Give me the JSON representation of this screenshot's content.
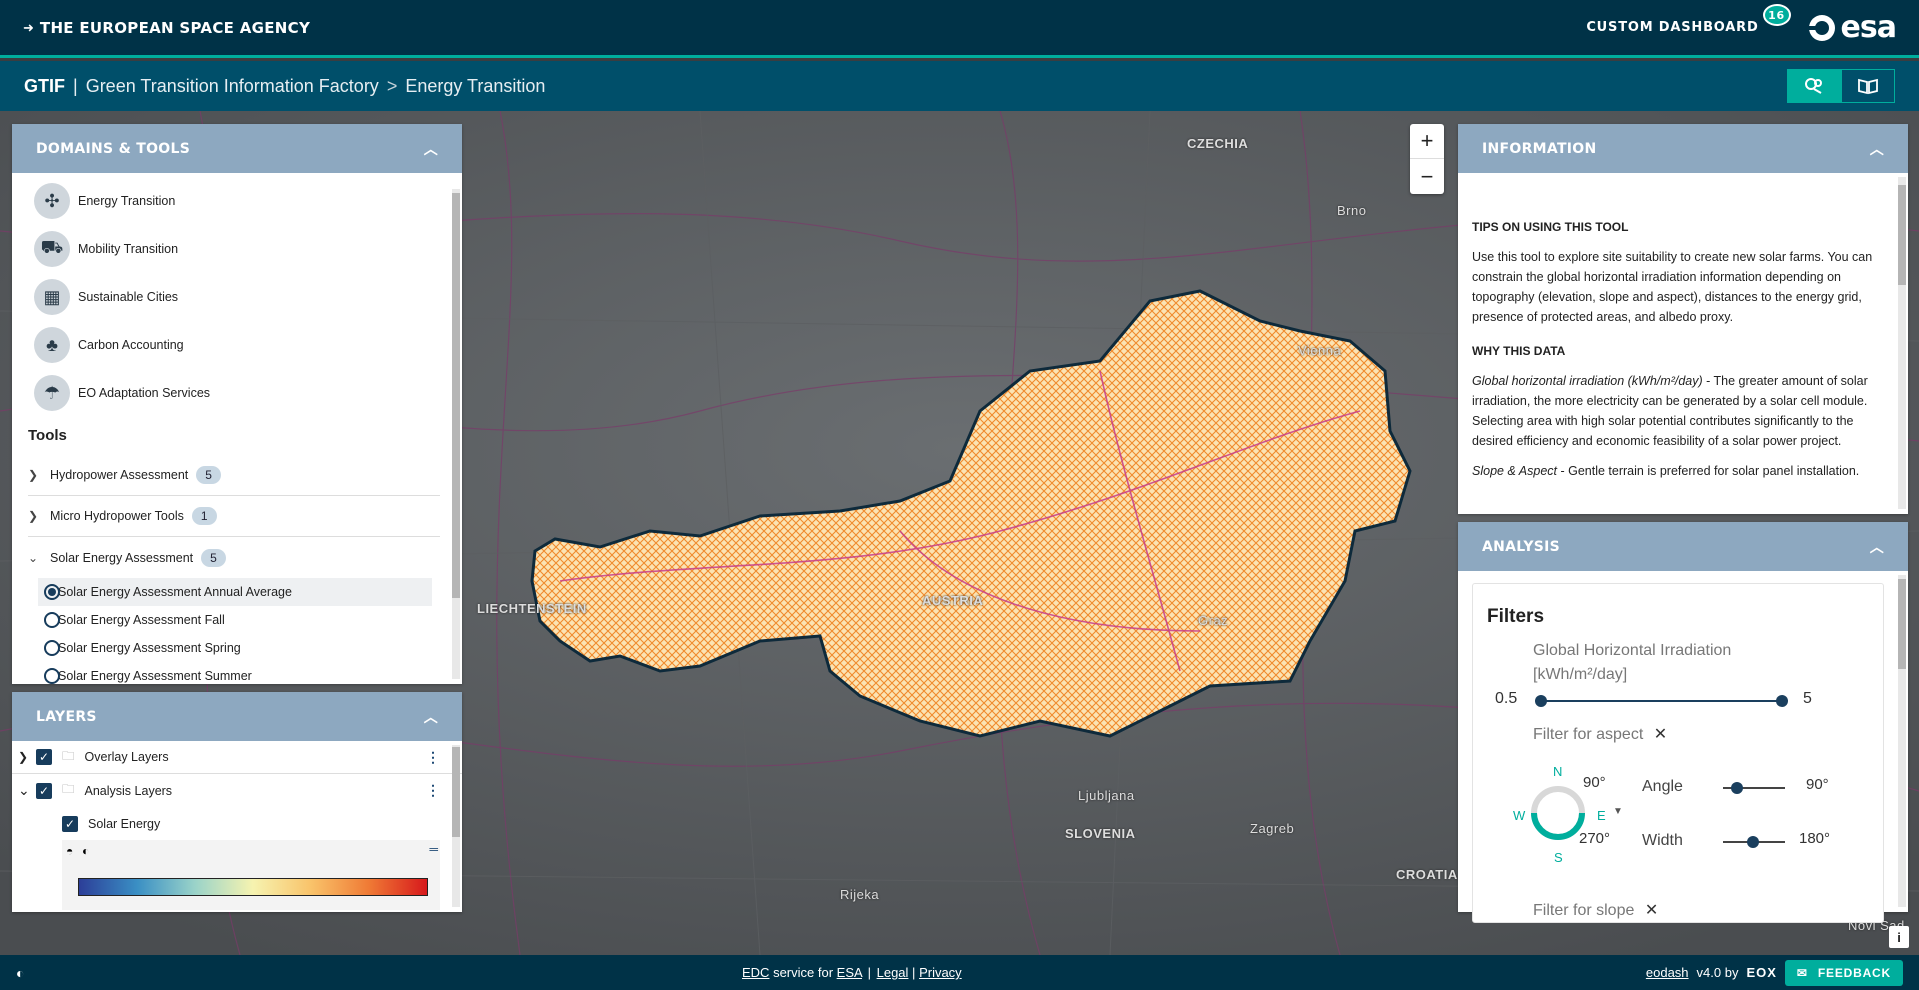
{
  "header": {
    "title": "THE EUROPEAN SPACE AGENCY",
    "custom_dashboard": "CUSTOM DASHBOARD",
    "dashboard_count": "16",
    "logo_text": "esa"
  },
  "breadcrumb": {
    "root": "GTIF",
    "separator": "|",
    "section": "Green Transition Information Factory",
    "arrow": ">",
    "page": "Energy Transition"
  },
  "domains_panel": {
    "title": "DOMAINS & TOOLS",
    "domains": [
      {
        "label": "Energy Transition",
        "icon": "wind-turbine-icon"
      },
      {
        "label": "Mobility Transition",
        "icon": "vehicle-icon"
      },
      {
        "label": "Sustainable Cities",
        "icon": "city-icon"
      },
      {
        "label": "Carbon Accounting",
        "icon": "forest-icon"
      },
      {
        "label": "EO Adaptation Services",
        "icon": "adaptation-icon"
      }
    ],
    "tools_heading": "Tools",
    "tools": [
      {
        "label": "Hydropower Assessment",
        "count": "5",
        "expanded": false
      },
      {
        "label": "Micro Hydropower Tools",
        "count": "1",
        "expanded": false
      },
      {
        "label": "Solar Energy Assessment",
        "count": "5",
        "expanded": true
      }
    ],
    "solar_options": [
      {
        "label": "Solar Energy Assessment Annual Average",
        "selected": true
      },
      {
        "label": "Solar Energy Assessment Fall",
        "selected": false
      },
      {
        "label": "Solar Energy Assessment Spring",
        "selected": false
      },
      {
        "label": "Solar Energy Assessment Summer",
        "selected": false
      }
    ]
  },
  "layers_panel": {
    "title": "LAYERS",
    "items": [
      {
        "label": "Overlay Layers"
      },
      {
        "label": "Analysis Layers"
      },
      {
        "label": "Solar Energy"
      }
    ]
  },
  "info_panel": {
    "title": "INFORMATION",
    "tips_heading": "TIPS ON USING THIS TOOL",
    "tips_text": "Use this tool to explore site suitability to create new solar farms. You can constrain the global horizontal irradiation information depending on topography (elevation, slope and aspect), distances to the energy grid, presence of protected areas, and albedo proxy.",
    "why_heading": "WHY THIS DATA",
    "why_term": "Global horizontal irradiation (kWh/m²/day)",
    "why_text": " - The greater amount of solar irradiation, the more electricity can be generated by a solar cell module. Selecting area with high solar potential contributes significantly to the desired efficiency and economic feasibility of a solar power project.",
    "slope_term": "Slope & Aspect",
    "slope_text": " - Gentle terrain is preferred for solar panel installation."
  },
  "analysis_panel": {
    "title": "ANALYSIS",
    "filters_heading": "Filters",
    "ghi_label": "Global Horizontal Irradiation [kWh/m²/day]",
    "ghi_min": "0.5",
    "ghi_max": "5",
    "aspect_filter": "Filter for aspect",
    "compass": {
      "n": "N",
      "e": "E",
      "s": "S",
      "w": "W",
      "from": "90°",
      "to": "270°"
    },
    "angle_label": "Angle",
    "angle_value": "90°",
    "width_label": "Width",
    "width_value": "180°",
    "slope_filter": "Filter for slope"
  },
  "map": {
    "labels": {
      "czechia": "CZECHIA",
      "brno": "Brno",
      "vienna": "Vienna",
      "liechtenstein": "LIECHTENSTEIN",
      "austria": "AUSTRIA",
      "graz": "Graz",
      "ljubljana": "Ljubljana",
      "slovenia": "SLOVENIA",
      "zagreb": "Zagreb",
      "croatia": "CROATIA",
      "rijeka": "Rijeka",
      "novisad": "Novi Sad"
    },
    "zoom_in": "+",
    "zoom_out": "−",
    "info": "i"
  },
  "footer": {
    "edc": "EDC",
    "service_for": "service for",
    "esa": "ESA",
    "legal": "Legal",
    "privacy": "Privacy",
    "eodash": "eodash",
    "version": "v4.0 by",
    "eox": "EOX",
    "feedback": "FEEDBACK"
  },
  "colors": {
    "header": "#003247",
    "accent": "#00ae9d",
    "subbar": "#004f6a",
    "panel_head": "#8da8c0"
  }
}
